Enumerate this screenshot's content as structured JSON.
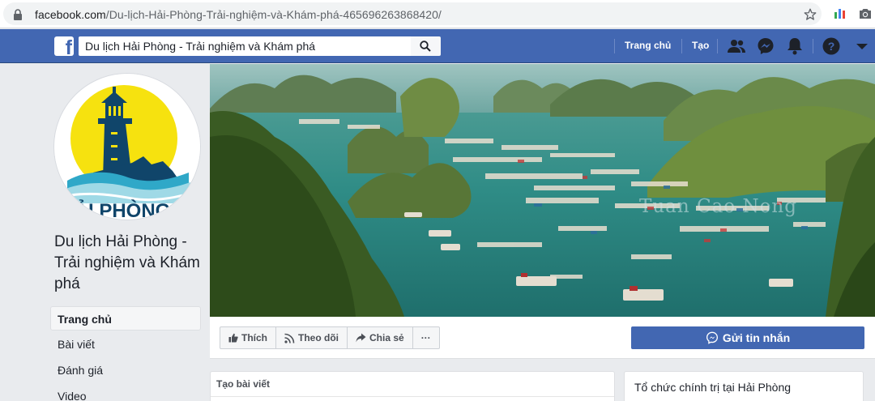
{
  "browser": {
    "url_host": "facebook.com",
    "url_path": "/Du-lịch-Hải-Phòng-Trải-nghiệm-và-Khám-phá-465696263868420/"
  },
  "fb": {
    "search_value": "Du lịch Hải Phòng - Trải nghiệm và Khám phá",
    "nav": {
      "home": "Trang chủ",
      "create": "Tạo"
    }
  },
  "page": {
    "logo_text": "ẢI PHÒNG",
    "title": "Du lịch Hải Phòng - Trải nghiệm và Khám phá",
    "sidebar": [
      {
        "label": "Trang chủ"
      },
      {
        "label": "Bài viết"
      },
      {
        "label": "Đánh giá"
      },
      {
        "label": "Video"
      }
    ],
    "cover_watermark": "Tuan Cao Nong",
    "actions": {
      "like": "Thích",
      "follow": "Theo dõi",
      "share": "Chia sẻ",
      "more": "···"
    },
    "message_button": "Gửi tin nhắn",
    "create_post": "Tạo bài viết",
    "category": "Tổ chức chính trị tại Hải Phòng"
  },
  "colors": {
    "fb_blue": "#4267b2",
    "background": "#e9ebee"
  }
}
